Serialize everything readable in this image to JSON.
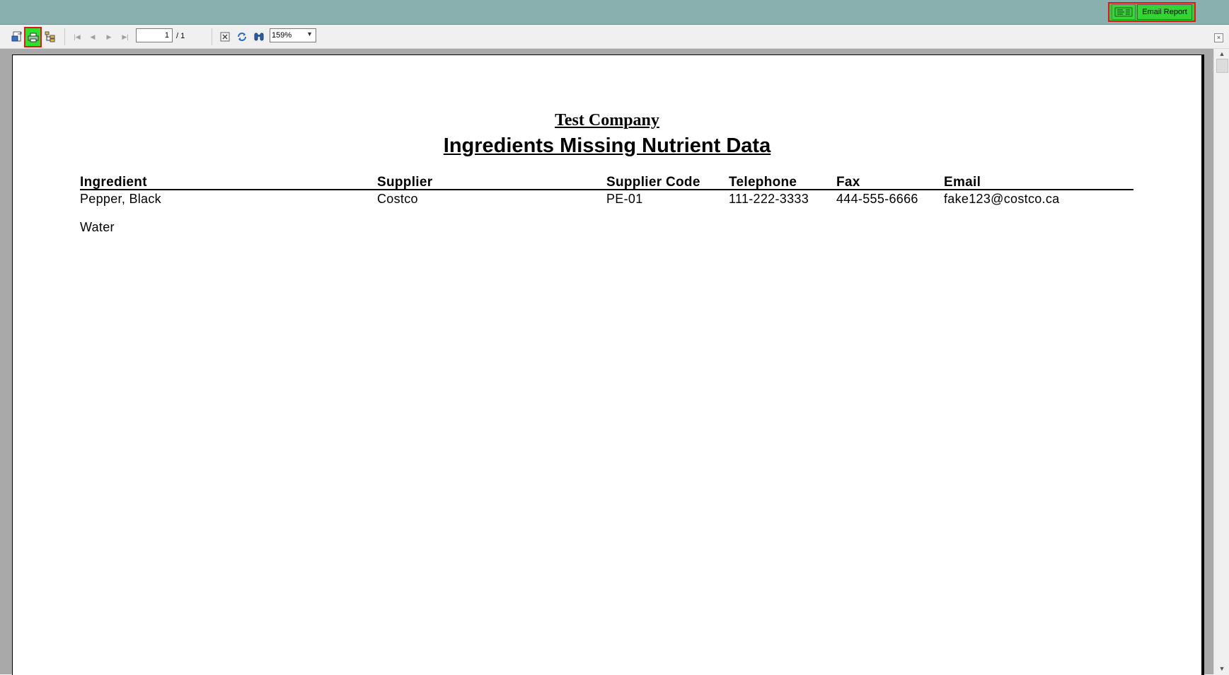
{
  "top_bar": {
    "email_button_label": "Email Report"
  },
  "toolbar": {
    "page_current": "1",
    "page_total": "/ 1",
    "zoom": "159%",
    "close_glyph": "×"
  },
  "report": {
    "company": "Test Company",
    "title": "Ingredients Missing Nutrient Data",
    "columns": [
      "Ingredient",
      "Supplier",
      "Supplier Code",
      "Telephone",
      "Fax",
      "Email"
    ],
    "rows": [
      [
        "Pepper, Black",
        "Costco",
        "PE-01",
        "111-222-3333",
        "444-555-6666",
        "fake123@costco.ca"
      ],
      [
        "Water",
        "",
        "",
        "",
        "",
        ""
      ]
    ]
  },
  "icons": {
    "export": "export-icon",
    "print": "print-icon",
    "group_tree": "group-tree-icon",
    "first_page": "first-page-icon",
    "prev_page": "previous-page-icon",
    "next_page": "next-page-icon",
    "last_page": "last-page-icon",
    "stop": "stop-icon",
    "refresh": "refresh-icon",
    "search": "binoculars-icon",
    "email": "email-icon"
  },
  "colors": {
    "top_bar": "#8aafaf",
    "highlight_fill": "#2fcf2f",
    "highlight_border": "#e0181d",
    "viewer_background": "#a9a9a9"
  }
}
